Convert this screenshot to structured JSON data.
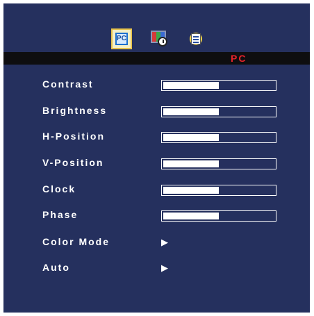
{
  "osd": {
    "tabs": [
      {
        "name": "pc-tab",
        "icon": "pc-icon",
        "glyph": "PC",
        "selected": true
      },
      {
        "name": "color-tab",
        "icon": "color-clock-icon",
        "selected": false
      },
      {
        "name": "setup-tab",
        "icon": "setup-document-icon",
        "selected": false
      }
    ],
    "section_title": "PC",
    "colors": {
      "background": "#25305e",
      "title_bar": "#0e0e10",
      "title_text": "#e8232a",
      "accent_tab": "#e8c34c"
    },
    "items": [
      {
        "label": "Contrast",
        "type": "slider",
        "level_fraction": 0.5
      },
      {
        "label": "Brightness",
        "type": "slider",
        "level_fraction": 0.5
      },
      {
        "label": "H-Position",
        "type": "slider",
        "level_fraction": 0.5
      },
      {
        "label": "V-Position",
        "type": "slider",
        "level_fraction": 0.5
      },
      {
        "label": "Clock",
        "type": "slider",
        "level_fraction": 0.5
      },
      {
        "label": "Phase",
        "type": "slider",
        "level_fraction": 0.5
      },
      {
        "label": "Color Mode",
        "type": "submenu",
        "arrow": "▶"
      },
      {
        "label": "Auto",
        "type": "submenu",
        "arrow": "▶"
      }
    ]
  }
}
